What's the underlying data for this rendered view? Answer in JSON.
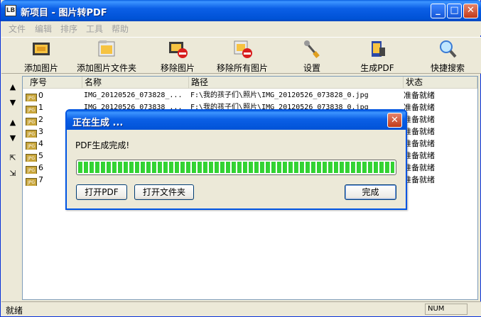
{
  "window": {
    "title": "新项目 - 图片转PDF",
    "icon_text": "LB",
    "buttons": {
      "minimize": "_",
      "maximize": "□",
      "close": "✕"
    }
  },
  "menu": [
    "文件",
    "编辑",
    "排序",
    "工具",
    "帮助"
  ],
  "toolbar": [
    {
      "label": "添加图片",
      "icon": "image-icon"
    },
    {
      "label": "添加图片文件夹",
      "icon": "image-folder-icon"
    },
    {
      "label": "移除图片",
      "icon": "remove-image-icon"
    },
    {
      "label": "移除所有图片",
      "icon": "remove-all-images-icon"
    },
    {
      "label": "设置",
      "icon": "settings-icon"
    },
    {
      "label": "生成PDF",
      "icon": "generate-pdf-icon"
    },
    {
      "label": "快捷搜索",
      "icon": "search-icon"
    }
  ],
  "sidebar": [
    {
      "glyph": "▲",
      "icon": "move-up-icon"
    },
    {
      "glyph": "▼",
      "icon": "move-down-icon"
    },
    {
      "glyph": "▲",
      "icon": "move-top-icon"
    },
    {
      "glyph": "▼",
      "icon": "move-bottom-icon"
    },
    {
      "glyph": "⇱",
      "icon": "expand-icon"
    },
    {
      "glyph": "⇲",
      "icon": "collapse-icon"
    }
  ],
  "list": {
    "columns": [
      "序号",
      "名称",
      "路径",
      "状态"
    ],
    "rows": [
      {
        "index": "0",
        "name": "IMG_20120526_073828_...",
        "path": "F:\\我的孩子们\\照片\\IMG_20120526_073828_0.jpg",
        "status": "准备就绪"
      },
      {
        "index": "1",
        "name": "IMG_20120526_073838_...",
        "path": "F:\\我的孩子们\\照片\\IMG_20120526_073838_0.jpg",
        "status": "准备就绪"
      },
      {
        "index": "2",
        "name": "",
        "path": "",
        "status": "准备就绪"
      },
      {
        "index": "3",
        "name": "",
        "path": "",
        "status": "准备就绪"
      },
      {
        "index": "4",
        "name": "",
        "path": "",
        "status": "准备就绪"
      },
      {
        "index": "5",
        "name": "",
        "path": "",
        "status": "准备就绪"
      },
      {
        "index": "6",
        "name": "",
        "path": "",
        "status": "准备就绪"
      },
      {
        "index": "7",
        "name": "",
        "path": "",
        "status": "准备就绪"
      }
    ],
    "file_badge": "JPG"
  },
  "dialog": {
    "title": "正在生成 ...",
    "message": "PDF生成完成!",
    "progress": 1.0,
    "buttons": {
      "open_pdf": "打开PDF",
      "open_folder": "打开文件夹",
      "done": "完成"
    },
    "close": "✕"
  },
  "status": {
    "text": "就绪",
    "num": "NUM"
  }
}
